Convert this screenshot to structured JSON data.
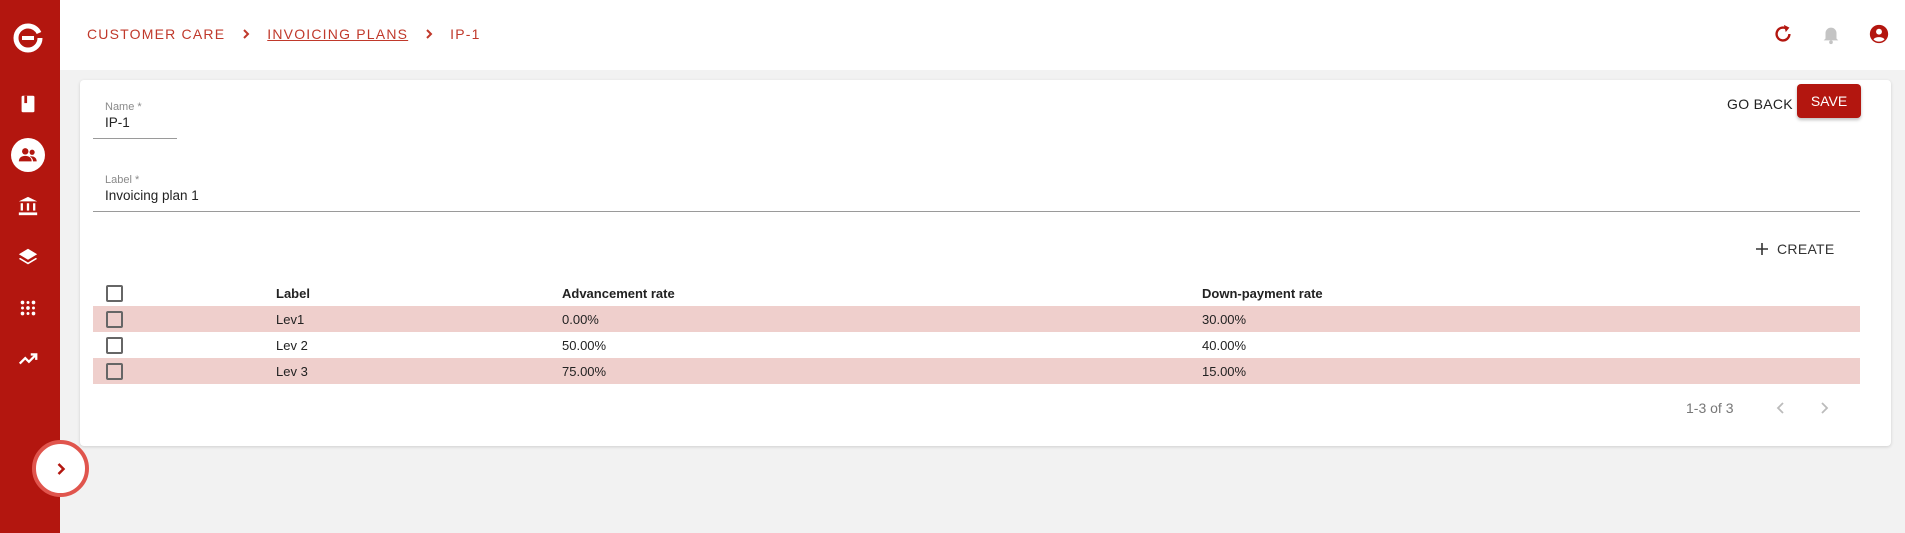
{
  "breadcrumb": {
    "root": "CUSTOMER CARE",
    "parent": "INVOICING PLANS",
    "current": "IP-1"
  },
  "form": {
    "name_label": "Name *",
    "name_value": "IP-1",
    "label_label": "Label *",
    "label_value": "Invoicing plan 1"
  },
  "actions": {
    "go_back": "GO BACK",
    "save": "SAVE",
    "create": "CREATE"
  },
  "table": {
    "columns": [
      "Label",
      "Advancement rate",
      "Down-payment rate"
    ],
    "rows": [
      {
        "label": "Lev1",
        "advancement": "0.00%",
        "downpayment": "30.00%"
      },
      {
        "label": "Lev 2",
        "advancement": "50.00%",
        "downpayment": "40.00%"
      },
      {
        "label": "Lev 3",
        "advancement": "75.00%",
        "downpayment": "15.00%"
      }
    ]
  },
  "pagination": {
    "range": "1-3 of 3"
  },
  "sidebar": {
    "items": [
      {
        "icon": "book-icon"
      },
      {
        "icon": "customers-icon",
        "active": true
      },
      {
        "icon": "bank-icon"
      },
      {
        "icon": "layers-icon"
      },
      {
        "icon": "dots-grid-icon"
      },
      {
        "icon": "trending-up-icon"
      }
    ]
  },
  "colors": {
    "brand": "#b3160f",
    "row_highlight": "#efcfcc",
    "breadcrumb": "#c0392b"
  }
}
